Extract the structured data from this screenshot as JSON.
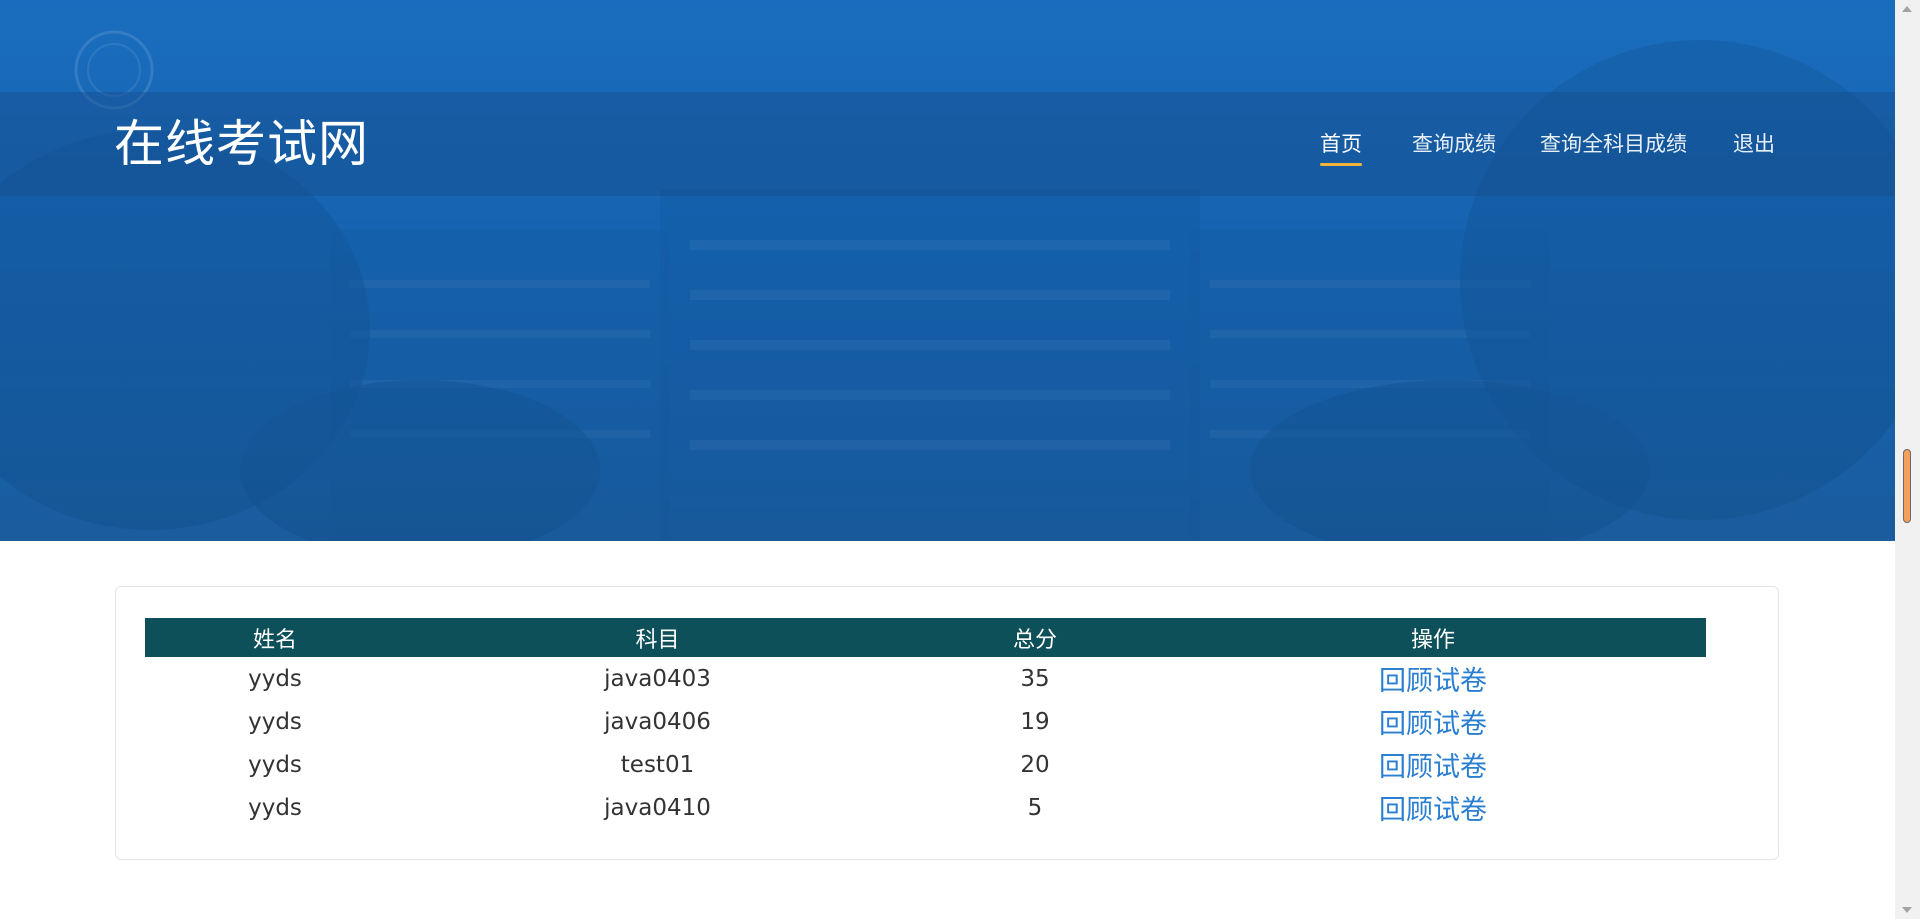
{
  "site": {
    "title": "在线考试网"
  },
  "nav": {
    "items": [
      {
        "label": "首页",
        "active": true
      },
      {
        "label": "查询成绩",
        "active": false
      },
      {
        "label": "查询全科目成绩",
        "active": false
      },
      {
        "label": "退出",
        "active": false
      }
    ]
  },
  "table": {
    "headers": [
      "姓名",
      "科目",
      "总分",
      "操作"
    ],
    "rows": [
      {
        "name": "yyds",
        "subject": "java0403",
        "score": "35",
        "action": "回顾试卷"
      },
      {
        "name": "yyds",
        "subject": "java0406",
        "score": "19",
        "action": "回顾试卷"
      },
      {
        "name": "yyds",
        "subject": "test01",
        "score": "20",
        "action": "回顾试卷"
      },
      {
        "name": "yyds",
        "subject": "java0410",
        "score": "5",
        "action": "回顾试卷"
      }
    ]
  },
  "colors": {
    "hero_blue": "#1a68b6",
    "nav_active_underline": "#f0b43c",
    "table_header_bg": "#0e505a",
    "link": "#2b7fd1",
    "scroll_thumb": "#f5a05a"
  }
}
